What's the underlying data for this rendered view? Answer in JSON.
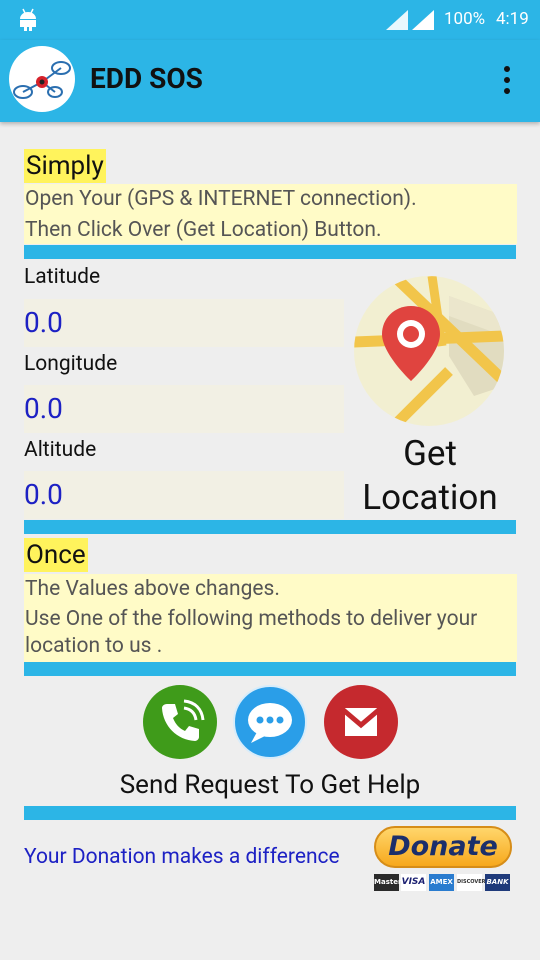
{
  "status_bar": {
    "battery": "100%",
    "time": "4:19"
  },
  "app_bar": {
    "title": "EDD SOS",
    "logo_icon": "drone-logo-icon",
    "menu_icon": "overflow-menu-icon"
  },
  "intro": {
    "heading": "Simply",
    "line1": "Open Your (GPS & INTERNET connection).",
    "line2": "Then Click Over (Get Location) Button."
  },
  "coords": {
    "latitude_label": "Latitude",
    "latitude_value": "0.0",
    "longitude_label": "Longitude",
    "longitude_value": "0.0",
    "altitude_label": "Altitude",
    "altitude_value": "0.0"
  },
  "get_location": {
    "line1": "Get",
    "line2": "Location",
    "icon": "map-pin-icon"
  },
  "once": {
    "heading": "Once",
    "line1": "The Values above changes.",
    "line2": "Use One of the following methods to deliver your",
    "line3": "location to us ."
  },
  "actions": {
    "call_icon": "phone-icon",
    "sms_icon": "message-icon",
    "mail_icon": "gmail-icon",
    "send_label": "Send Request To Get Help"
  },
  "donation": {
    "text": "Your Donation makes a difference",
    "button_label": "Donate",
    "cards": [
      "MasterCard",
      "VISA",
      "AMEX",
      "DISCOVER",
      "BANK"
    ]
  },
  "colors": {
    "accent": "#2cb5e6",
    "highlight": "#fff35c",
    "note_bg": "#fffbc7",
    "value_text": "#1d21c4"
  }
}
